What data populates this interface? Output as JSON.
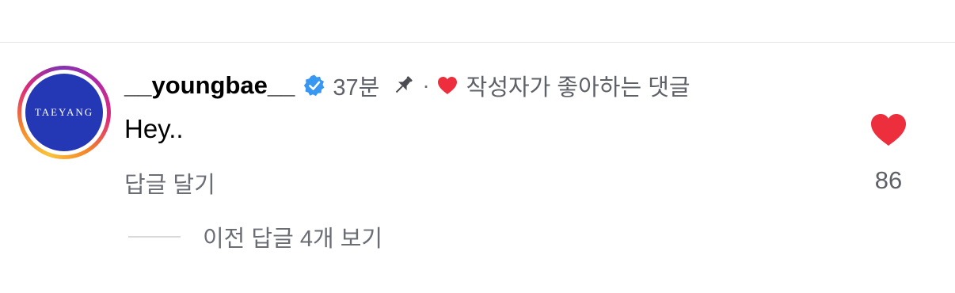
{
  "comment": {
    "avatar_text": "TAEYANG",
    "username": "__youngbae__",
    "verified_icon": "verified-badge-icon",
    "time": "37분",
    "pin_icon": "pin-icon",
    "separator": "·",
    "author_like_icon": "heart-icon",
    "liked_by_author_label": "작성자가 좋아하는 댓글",
    "text": "Hey..",
    "reply_label": "답글 달기",
    "like_icon": "heart-filled-icon",
    "like_count": "86",
    "view_replies_label": "이전 답글 4개 보기"
  },
  "colors": {
    "verified_blue": "#3897f0",
    "heart_red": "#ed2f3d",
    "secondary_text": "#5f6168",
    "avatar_blue": "#2438b6"
  }
}
